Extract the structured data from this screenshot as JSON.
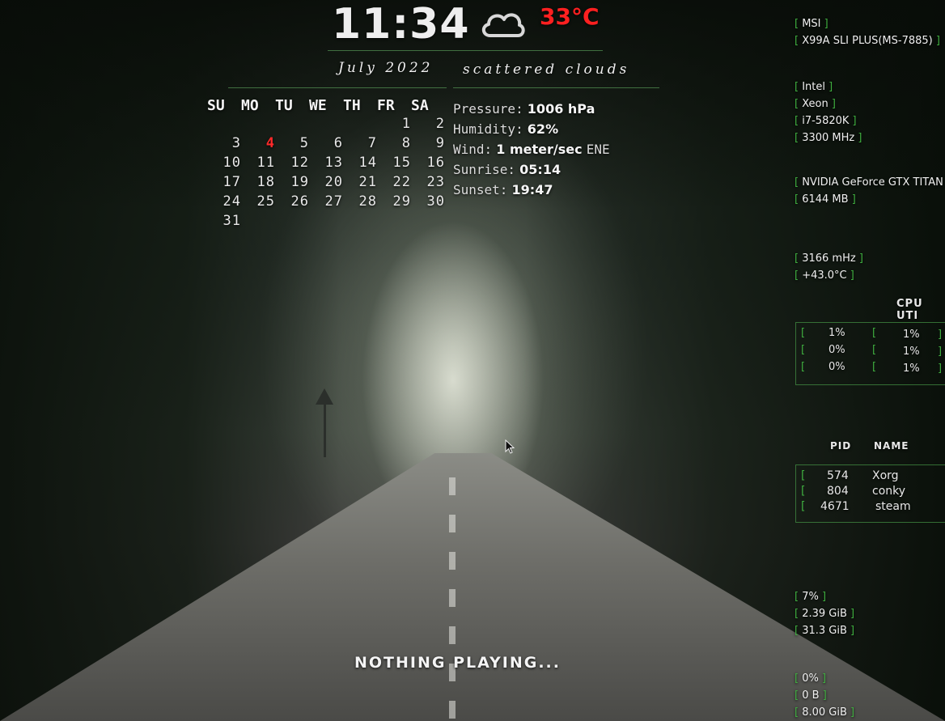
{
  "clock": {
    "time": "11:34"
  },
  "weather": {
    "icon": "cloud-icon",
    "temperature": "33°C",
    "date": "July 2022",
    "condition": "scattered clouds",
    "pressure_label": "Pressure:",
    "pressure": "1006 hPa",
    "humidity_label": "Humidity:",
    "humidity": "62%",
    "wind_label": "Wind:",
    "wind": "1 meter/sec",
    "wind_dir": "ENE",
    "sunrise_label": "Sunrise:",
    "sunrise": "05:14",
    "sunset_label": "Sunset:",
    "sunset": "19:47",
    "temp_color": "#ff2020"
  },
  "calendar": {
    "days": [
      "SU",
      "MO",
      "TU",
      "WE",
      "TH",
      "FR",
      "SA"
    ],
    "rows": [
      [
        "",
        "",
        "",
        "",
        "",
        "1",
        "2"
      ],
      [
        "3",
        "4",
        "5",
        "6",
        "7",
        "8",
        "9"
      ],
      [
        "10",
        "11",
        "12",
        "13",
        "14",
        "15",
        "16"
      ],
      [
        "17",
        "18",
        "19",
        "20",
        "21",
        "22",
        "23"
      ],
      [
        "24",
        "25",
        "26",
        "27",
        "28",
        "29",
        "30"
      ],
      [
        "31",
        "",
        "",
        "",
        "",
        "",
        ""
      ]
    ],
    "today": "4",
    "today_color": "#ff2a2a"
  },
  "system": {
    "board_vendor": "MSI",
    "board_model": "X99A SLI PLUS(MS-7885)",
    "cpu_vendor": "Intel",
    "cpu_family": "Xeon",
    "cpu_model": "i7-5820K",
    "cpu_freq": "3300 MHz",
    "gpu_name": "NVIDIA GeForce GTX TITAN",
    "gpu_mem": "6144 MB",
    "gpu_freq": "3166 mHz",
    "gpu_temp": "+43.0°C",
    "cpu_usage_title": "CPU UTI",
    "cpu_cores": [
      "1%",
      "1%",
      "0%",
      "1%",
      "0%",
      "1%"
    ],
    "proc_header_pid": "PID",
    "proc_header_name": "NAME",
    "processes": [
      {
        "pid": "574",
        "name": "Xorg"
      },
      {
        "pid": "804",
        "name": "conky"
      },
      {
        "pid": "4671",
        "name": "steam"
      }
    ],
    "mem_percent": "7%",
    "mem_used": "2.39 GiB",
    "mem_total": "31.3 GiB",
    "swap_percent": "0%",
    "swap_used": "0 B",
    "swap_total": "8.00 GiB",
    "accent_color": "#3fae3f"
  },
  "media": {
    "now_playing": "NOTHING PLAYING..."
  }
}
